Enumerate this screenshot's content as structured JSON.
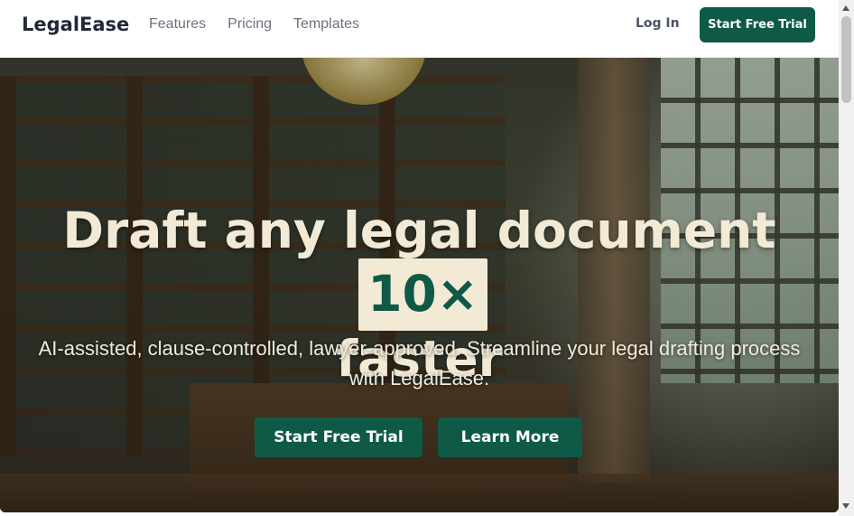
{
  "header": {
    "brand": "LegalEase",
    "nav": [
      "Features",
      "Pricing",
      "Templates"
    ],
    "login_label": "Log In",
    "cta_label": "Start Free Trial"
  },
  "hero": {
    "headline_part1": "Draft any legal document",
    "headline_badge": "10×",
    "headline_part2": "faster",
    "subheadline": "AI-assisted, clause-controlled, lawyer-approved. Streamline your legal drafting process with LegalEase.",
    "primary_button": "Start Free Trial",
    "secondary_button": "Learn More"
  },
  "colors": {
    "accent": "#0f5a47",
    "headline": "#f3ead6"
  }
}
